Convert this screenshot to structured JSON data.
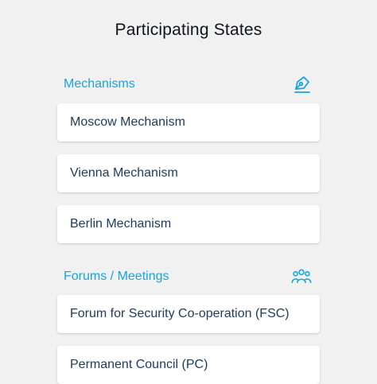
{
  "page": {
    "title": "Participating States"
  },
  "sections": [
    {
      "title": "Mechanisms",
      "icon": "pen-nib-icon",
      "items": [
        {
          "label": "Moscow Mechanism"
        },
        {
          "label": "Vienna Mechanism"
        },
        {
          "label": "Berlin Mechanism"
        }
      ]
    },
    {
      "title": "Forums / Meetings",
      "icon": "people-group-icon",
      "items": [
        {
          "label": "Forum for Security Co-operation (FSC)"
        },
        {
          "label": "Permanent Council (PC)"
        }
      ]
    }
  ],
  "colors": {
    "background": "#f1f1f2",
    "accent": "#1aa3de",
    "card_text": "#1d3a5f",
    "title_text": "#111418"
  }
}
